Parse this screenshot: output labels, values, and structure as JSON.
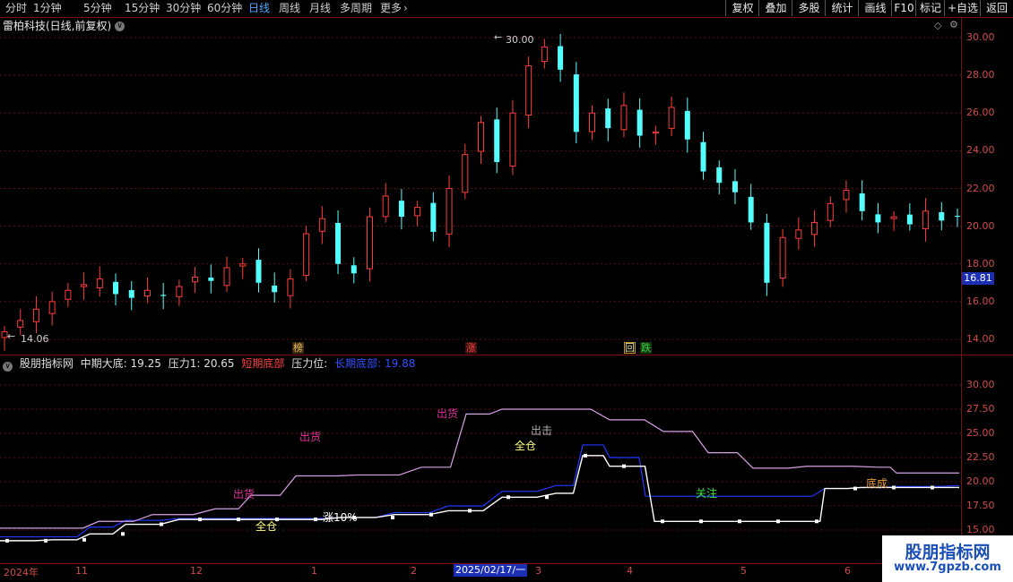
{
  "toolbar": {
    "periods": [
      "分时",
      "1分钟",
      "5分钟",
      "15分钟",
      "30分钟",
      "60分钟",
      "日线",
      "周线",
      "月线",
      "多周期",
      "更多"
    ],
    "active_period": "日线",
    "right_buttons": [
      "复权",
      "叠加",
      "多股",
      "统计",
      "画线",
      "F10",
      "标记",
      "+自选",
      "返回"
    ]
  },
  "stock": {
    "title": "雷柏科技(日线,前复权)"
  },
  "main_chart": {
    "y_ticks": [
      "30.00",
      "28.00",
      "26.00",
      "24.00",
      "22.00",
      "20.00",
      "18.00",
      "16.00",
      "14.00"
    ],
    "high_label": "30.00",
    "low_label": "14.06",
    "current_price": "16.81",
    "tags": [
      {
        "text": "榜",
        "color": "#e8c060"
      },
      {
        "text": "涨",
        "color": "#ff4040"
      },
      {
        "text": "回",
        "color": "#e8e0a0"
      },
      {
        "text": "跌",
        "color": "#40d040"
      }
    ]
  },
  "indicator": {
    "name": "股朋指标网",
    "mid_bottom_label": "中期大底: 19.25",
    "pressure_label": "压力1: 20.65",
    "short_bottom_label": "短期底部",
    "pressure_pos_label": "压力位:",
    "long_bottom_label": "长期底部: 19.88",
    "y_ticks": [
      "30.00",
      "27.50",
      "25.00",
      "22.50",
      "20.00",
      "17.50",
      "15.00"
    ],
    "signals": [
      {
        "text": "出货",
        "color": "#e0309a"
      },
      {
        "text": "出货",
        "color": "#e0309a"
      },
      {
        "text": "出货",
        "color": "#e0309a"
      },
      {
        "text": "出击",
        "color": "#b0b0b0"
      },
      {
        "text": "全仓",
        "color": "#ffff80"
      },
      {
        "text": "全仓",
        "color": "#ffff80"
      },
      {
        "text": "涨10%",
        "color": "#ffffff"
      },
      {
        "text": "关注",
        "color": "#40e040"
      },
      {
        "text": "底成",
        "color": "#e8a040"
      }
    ]
  },
  "x_axis": {
    "labels": [
      "2024年",
      "11",
      "12",
      "1",
      "2",
      "3",
      "4",
      "5",
      "6"
    ],
    "selected": "2025/02/17/一"
  },
  "watermark": {
    "line1": "股朋指标网",
    "line2": "www.7gpzb.com"
  },
  "chart_data": [
    {
      "type": "candlestick",
      "title": "雷柏科技(日线,前复权)",
      "ylim": [
        13.5,
        31
      ],
      "max": 30.0,
      "min": 14.06,
      "last": 16.81,
      "approx_closes": [
        14.4,
        15.0,
        15.6,
        16.0,
        16.6,
        16.9,
        17.2,
        16.4,
        16.2,
        16.6,
        16.3,
        16.8,
        17.3,
        17.1,
        17.8,
        18.0,
        17.0,
        16.5,
        17.2,
        19.6,
        20.4,
        18.0,
        17.5,
        20.5,
        21.6,
        20.5,
        21.0,
        19.7,
        22.0,
        23.8,
        25.5,
        23.4,
        26.0,
        28.5,
        29.5,
        28.3,
        25.0,
        26.0,
        25.2,
        26.4,
        24.8,
        25.0,
        26.3,
        24.6,
        22.9,
        22.3,
        21.8,
        20.2,
        17.0,
        19.4,
        19.8,
        20.2,
        21.2,
        21.9,
        20.8,
        20.2,
        20.5,
        20.1,
        20.8,
        20.3,
        20.5
      ]
    },
    {
      "type": "line",
      "title": "股朋指标网",
      "ylim": [
        13.5,
        32
      ],
      "series": [
        {
          "name": "长期底部",
          "color": "#2038ff",
          "x": [
            0,
            60,
            100,
            140,
            200,
            260,
            320,
            380,
            440,
            500,
            560,
            620,
            650,
            660,
            680,
            700,
            720,
            760,
            800,
            840,
            880,
            920,
            960,
            1000,
            1070
          ],
          "values": [
            14.3,
            14.3,
            15.3,
            16.0,
            16.2,
            16.2,
            16.2,
            16.3,
            16.8,
            17.5,
            19.0,
            19.6,
            23.8,
            23.8,
            22.5,
            22.5,
            18.5,
            18.5,
            18.5,
            18.5,
            18.5,
            19.3,
            19.4,
            19.5,
            19.6
          ]
        },
        {
          "name": "短期底部",
          "color": "#ffffff",
          "x": [
            0,
            60,
            100,
            140,
            200,
            260,
            320,
            380,
            440,
            500,
            560,
            620,
            650,
            660,
            680,
            700,
            730,
            760,
            800,
            840,
            880,
            905,
            920,
            960,
            1000,
            1070
          ],
          "values": [
            13.9,
            14.0,
            14.6,
            15.6,
            16.1,
            16.1,
            16.1,
            16.3,
            16.6,
            17.0,
            18.4,
            18.8,
            22.7,
            22.7,
            21.6,
            21.6,
            15.9,
            15.9,
            15.9,
            15.9,
            15.9,
            15.9,
            19.3,
            19.4,
            19.4,
            19.4
          ]
        },
        {
          "name": "压力位",
          "color": "#d8a0e8",
          "x": [
            0,
            60,
            110,
            170,
            240,
            280,
            330,
            400,
            470,
            520,
            560,
            620,
            680,
            740,
            790,
            840,
            900,
            980,
            1000,
            1070
          ],
          "values": [
            15.2,
            15.2,
            15.9,
            16.6,
            17.2,
            18.6,
            20.6,
            20.7,
            21.5,
            27.0,
            27.5,
            27.5,
            26.4,
            25.2,
            23.0,
            21.4,
            21.6,
            21.5,
            20.9,
            20.9
          ]
        }
      ]
    }
  ]
}
